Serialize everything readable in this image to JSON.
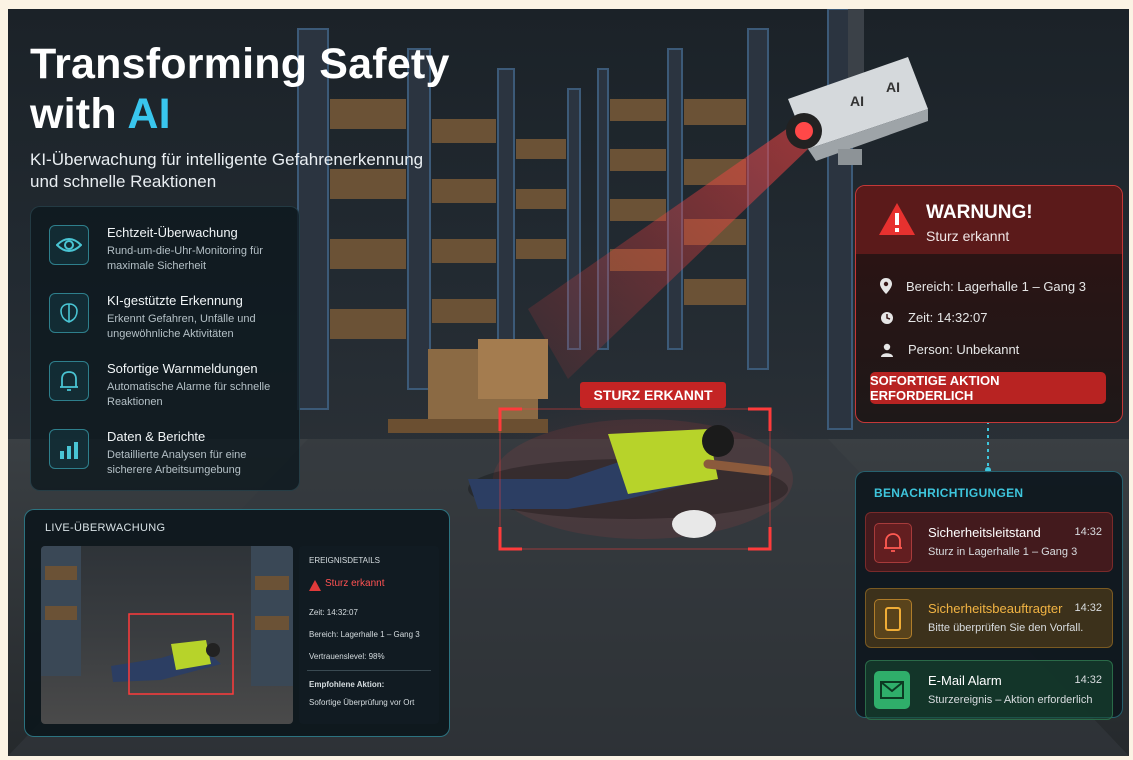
{
  "hero": {
    "title_line1": "Transforming Safety",
    "title_with": "with ",
    "title_ai": "AI",
    "subtitle": "KI-Überwachung für intelligente Gefahrenerkennung und schnelle Reaktionen"
  },
  "camera": {
    "label_left": "AI",
    "label_right": "AI"
  },
  "features": [
    {
      "icon": "eye-icon",
      "title": "Echtzeit-Überwachung",
      "desc": "Rund-um-die-Uhr-Monitoring für maximale Sicherheit"
    },
    {
      "icon": "brain-chip-icon",
      "title": "KI-gestützte Erkennung",
      "desc": "Erkennt Gefahren, Unfälle und ungewöhnliche Aktivitäten"
    },
    {
      "icon": "bell-icon",
      "title": "Sofortige Warnmeldungen",
      "desc": "Automatische Alarme für schnelle Reaktionen"
    },
    {
      "icon": "chart-icon",
      "title": "Daten & Berichte",
      "desc": "Detaillierte Analysen für eine sicherere Arbeitsumgebung"
    }
  ],
  "detection": {
    "label": "STURZ ERKANNT"
  },
  "live": {
    "header": "LIVE-ÜBERWACHUNG",
    "event_header": "EREIGNISDETAILS",
    "event_title": "Sturz erkannt",
    "time": "Zeit: 14:32:07",
    "area": "Bereich: Lagerhalle 1 – Gang 3",
    "confidence": "Vertrauenslevel: 98%",
    "action_label": "Empfohlene Aktion:",
    "action_text": "Sofortige Überprüfung vor Ort"
  },
  "warning": {
    "title": "WARNUNG!",
    "subtitle": "Sturz erkannt",
    "area": "Bereich: Lagerhalle 1 – Gang 3",
    "time": "Zeit: 14:32:07",
    "person": "Person: Unbekannt",
    "button": "SOFORTIGE AKTION ERFORDERLICH"
  },
  "notifications": {
    "header": "BENACHRICHTIGUNGEN",
    "items": [
      {
        "icon": "bell-icon",
        "title": "Sicherheitsleitstand",
        "message": "Sturz in Lagerhalle 1 – Gang 3",
        "time": "14:32",
        "color": "#c9403d"
      },
      {
        "icon": "phone-icon",
        "title": "Sicherheitsbeauftragter",
        "message": "Bitte überprüfen Sie den Vorfall.",
        "time": "14:32",
        "color": "#e2a233"
      },
      {
        "icon": "mail-icon",
        "title": "E-Mail Alarm",
        "message": "Sturzereignis – Aktion erforderlich",
        "time": "14:32",
        "color": "#2fae6a"
      }
    ]
  },
  "colors": {
    "accent": "#39c6ee",
    "alert": "#c42424",
    "panel": "#0e181e"
  }
}
